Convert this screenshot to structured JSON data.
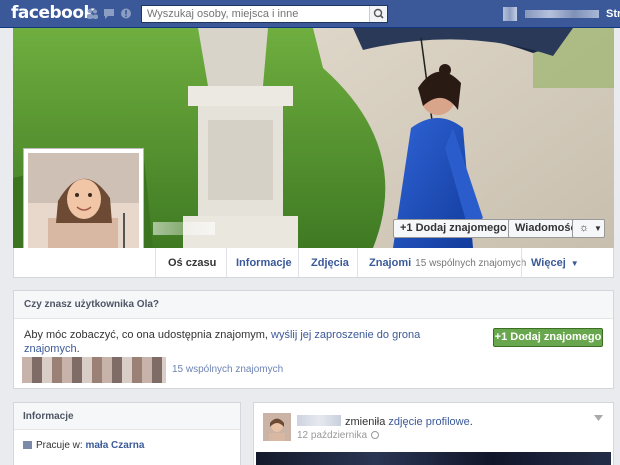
{
  "topbar": {
    "logo": "facebook",
    "search_placeholder": "Wyszukaj osoby, miejsca i inne",
    "right_link": "Stro"
  },
  "cover": {
    "add_friend_label": "Dodaj znajomego",
    "message_label": "Wiadomość",
    "gear_symbol": "☼",
    "caret_symbol": "▼"
  },
  "nav": {
    "timeline": "Oś czasu",
    "about": "Informacje",
    "photos": "Zdjęcia",
    "friends": "Znajomi",
    "friends_sub": "15 wspólnych znajomych",
    "more": "Więcej",
    "more_caret": "▼"
  },
  "friend_box": {
    "heading": "Czy znasz użytkownika Ola?",
    "text_prefix": "Aby móc zobaczyć, co ona udostępnia znajomym,",
    "text_link": "wyślij jej zaproszenie do grona znajomych",
    "text_suffix": ".",
    "button_label": "Dodaj znajomego",
    "mutual_friends": "15 wspólnych znajomych"
  },
  "info_card": {
    "heading": "Informacje",
    "work_prefix": "Pracuje w:",
    "work_link": "mała Czarna"
  },
  "post": {
    "action_text": "zmieniła",
    "action_link": "zdjęcie profilowe",
    "action_suffix": ".",
    "date": "12 października"
  },
  "colors": {
    "topbar": "#3b5998",
    "link": "#3b5998",
    "green_button": "#69a74e",
    "page_background": "#e9ebee"
  }
}
